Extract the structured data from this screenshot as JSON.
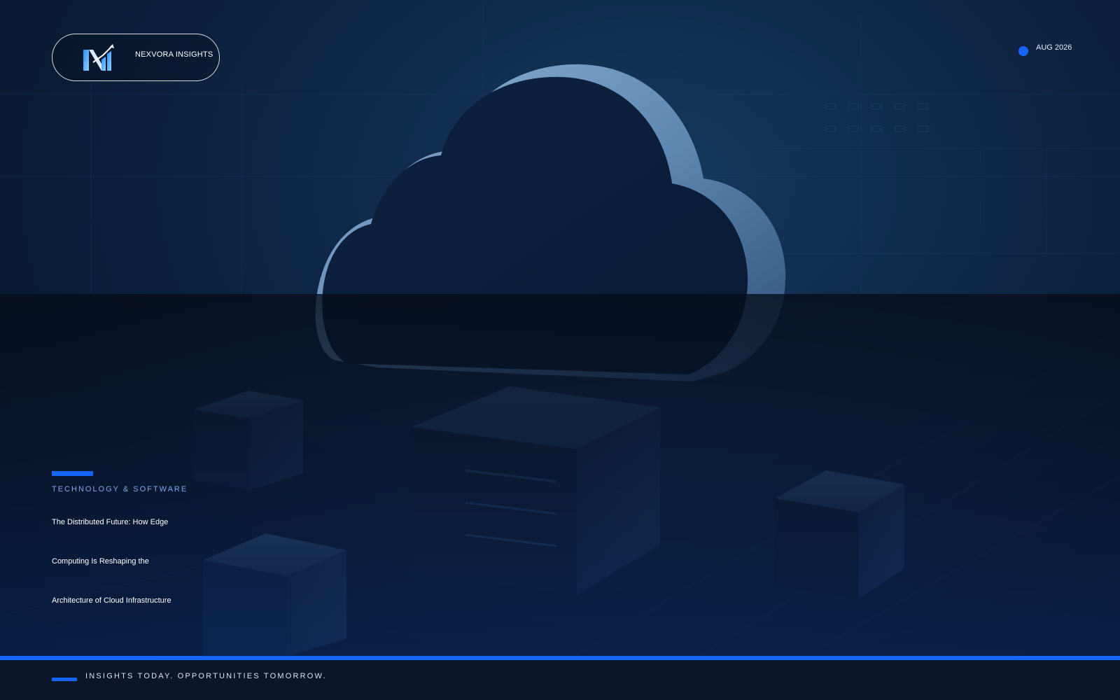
{
  "brand": {
    "name": "NEXVORA INSIGHTS",
    "logo_icon": "nexvora-n-growth-icon"
  },
  "meta": {
    "date": "AUG 2026"
  },
  "article": {
    "category": "TECHNOLOGY & SOFTWARE",
    "headline_lines": [
      "The Distributed Future: How Edge",
      "Computing Is Reshaping the",
      "Architecture of Cloud Infrastructure"
    ]
  },
  "footer": {
    "tagline": "INSIGHTS TODAY. OPPORTUNITIES TOMORROW."
  },
  "colors": {
    "accent": "#1565ff",
    "background_dark": "#0a1428",
    "category_text": "#7fa6ea"
  },
  "illustration": {
    "icon": "cloud-servers-illustration"
  }
}
